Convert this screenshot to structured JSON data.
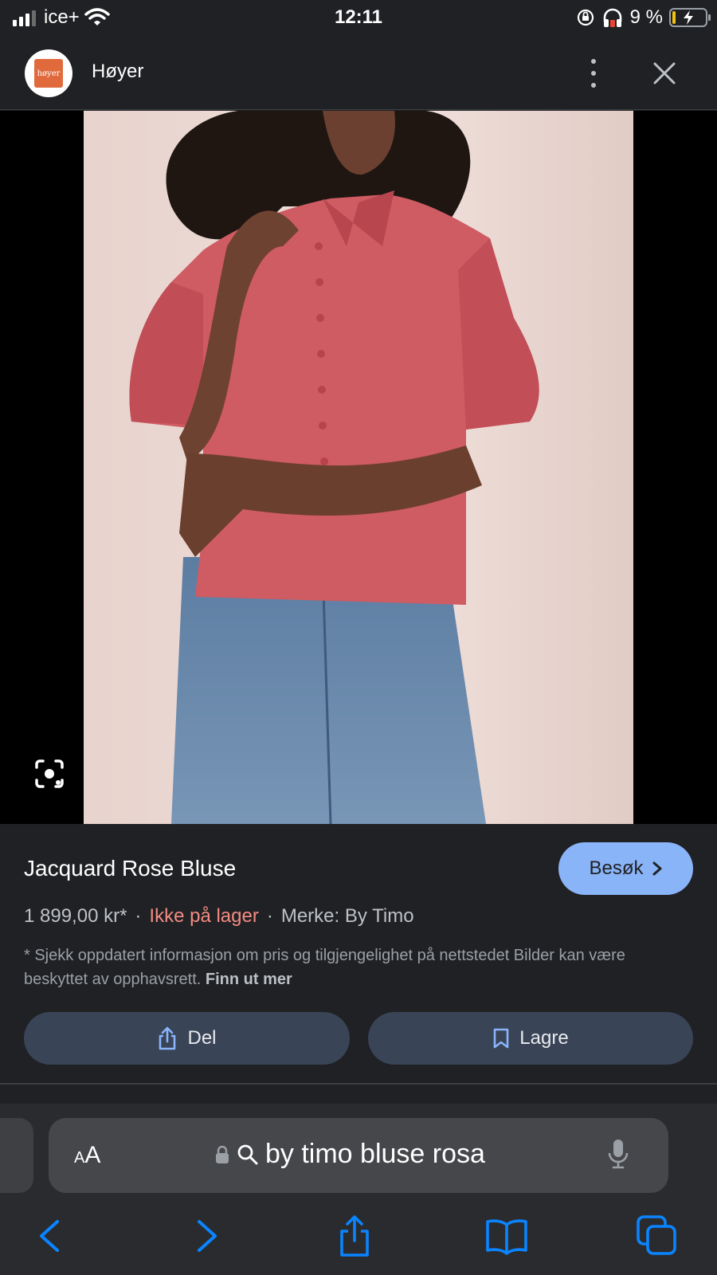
{
  "status_bar": {
    "carrier": "ice+",
    "time": "12:11",
    "battery_text": "9 %",
    "battery_level": 0.09,
    "icons": [
      "signal-icon",
      "wifi-icon",
      "orientation-lock-icon",
      "headphones-icon",
      "battery-charging-icon"
    ]
  },
  "header": {
    "logo_text": "høyer",
    "site_name": "Høyer",
    "icons": [
      "more-vert-icon",
      "close-icon"
    ]
  },
  "image": {
    "description_icon": "google-lens-icon"
  },
  "product": {
    "title": "Jacquard Rose Bluse",
    "visit_label": "Besøk",
    "price": "1 899,00 kr*",
    "separator": "·",
    "stock_status": "Ikke på lager",
    "brand": "Merke: By Timo",
    "disclaimer": "* Sjekk oppdatert informasjon om pris og tilgjengelighet på nettstedet Bilder kan være beskyttet av opphavsrett.",
    "learn_more": "Finn ut mer",
    "share_label": "Del",
    "save_label": "Lagre"
  },
  "safari": {
    "aa_small": "A",
    "aa_large": "A",
    "address_text": "by timo bluse rosa",
    "toolbar_icons": [
      "back-icon",
      "forward-icon",
      "share-icon",
      "bookmarks-icon",
      "tabs-icon"
    ]
  },
  "colors": {
    "background": "#202124",
    "accent": "#8ab4f8",
    "out_of_stock": "#f28b82",
    "action_button": "#394457",
    "safari_blue": "#0a84ff"
  }
}
